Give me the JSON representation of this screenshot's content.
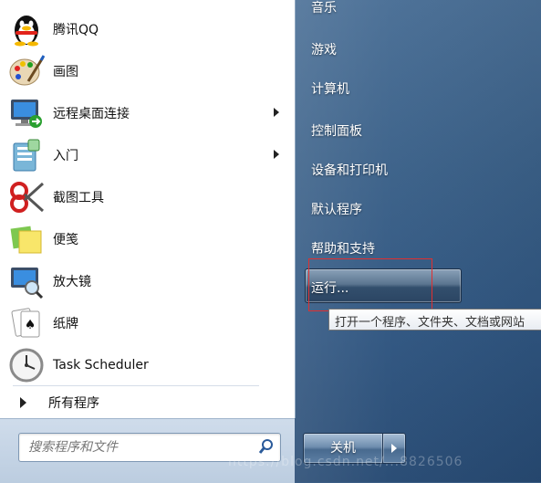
{
  "programs": [
    {
      "label": "腾讯QQ",
      "icon": "qq-penguin-icon",
      "arrow": false
    },
    {
      "label": "画图",
      "icon": "paint-palette-icon",
      "arrow": false
    },
    {
      "label": "远程桌面连接",
      "icon": "remote-desktop-icon",
      "arrow": true
    },
    {
      "label": "入门",
      "icon": "getting-started-icon",
      "arrow": true
    },
    {
      "label": "截图工具",
      "icon": "snipping-tool-icon",
      "arrow": false
    },
    {
      "label": "便笺",
      "icon": "sticky-notes-icon",
      "arrow": false
    },
    {
      "label": "放大镜",
      "icon": "magnifier-icon",
      "arrow": false
    },
    {
      "label": "纸牌",
      "icon": "solitaire-cards-icon",
      "arrow": false
    },
    {
      "label": "Task Scheduler",
      "icon": "task-scheduler-clock-icon",
      "arrow": false
    }
  ],
  "all_programs_label": "所有程序",
  "search": {
    "placeholder": "搜索程序和文件"
  },
  "right_items": [
    "音乐",
    "游戏",
    "计算机",
    "控制面板",
    "设备和打印机",
    "默认程序",
    "帮助和支持"
  ],
  "run": {
    "label": "运行...",
    "tooltip": "打开一个程序、文件夹、文档或网站"
  },
  "shutdown": {
    "label": "关机"
  },
  "watermark": "https://blog.csdn.net/...8826506",
  "colors": {
    "highlight": "#e03030",
    "panel": "#ffffff"
  }
}
